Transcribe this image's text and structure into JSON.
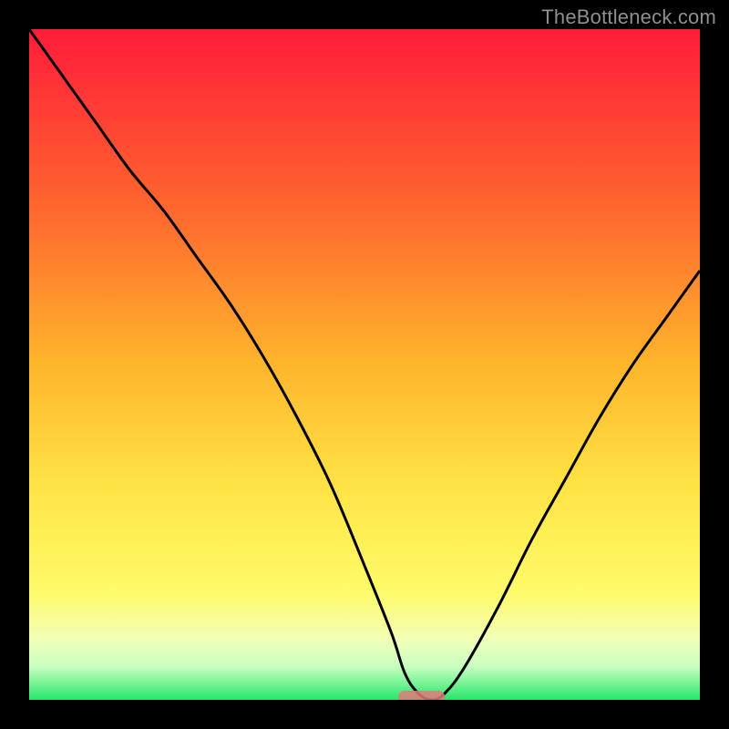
{
  "attribution": "TheBottleneck.com",
  "colors": {
    "frame": "#000000",
    "gradient_top": "#ff1c3a",
    "gradient_mid1": "#ff6a2e",
    "gradient_mid2": "#ffb52c",
    "gradient_mid3": "#ffe345",
    "gradient_yellow": "#fffb6a",
    "gradient_light": "#f2ffb8",
    "gradient_pale": "#c9ffc0",
    "gradient_green": "#27e76b",
    "curve": "#000000",
    "marker": "#e07a7a"
  },
  "chart_data": {
    "type": "line",
    "title": "",
    "xlabel": "",
    "ylabel": "",
    "xlim": [
      0,
      100
    ],
    "ylim": [
      0,
      100
    ],
    "grid": false,
    "legend_position": "none",
    "gradient_stops": [
      {
        "offset": 0.0,
        "color": "#ff1c3a"
      },
      {
        "offset": 0.28,
        "color": "#ff6a2e"
      },
      {
        "offset": 0.5,
        "color": "#ffb52c"
      },
      {
        "offset": 0.68,
        "color": "#ffe345"
      },
      {
        "offset": 0.84,
        "color": "#fffb6a"
      },
      {
        "offset": 0.91,
        "color": "#f2ffb8"
      },
      {
        "offset": 0.95,
        "color": "#c9ffc0"
      },
      {
        "offset": 1.0,
        "color": "#27e76b"
      }
    ],
    "series": [
      {
        "name": "bottleneck-curve",
        "x": [
          0,
          5,
          10,
          15,
          20,
          25,
          30,
          35,
          40,
          45,
          50,
          54,
          56,
          58,
          60,
          62,
          65,
          70,
          75,
          80,
          85,
          90,
          95,
          100
        ],
        "y": [
          100,
          93,
          86,
          79,
          73,
          66,
          59,
          51,
          42,
          32,
          20,
          10,
          4,
          1,
          0,
          1,
          5,
          14,
          24,
          33,
          42,
          50,
          57,
          64
        ]
      }
    ],
    "optimal_region": {
      "x_start": 55,
      "x_end": 62,
      "y": 0
    }
  }
}
